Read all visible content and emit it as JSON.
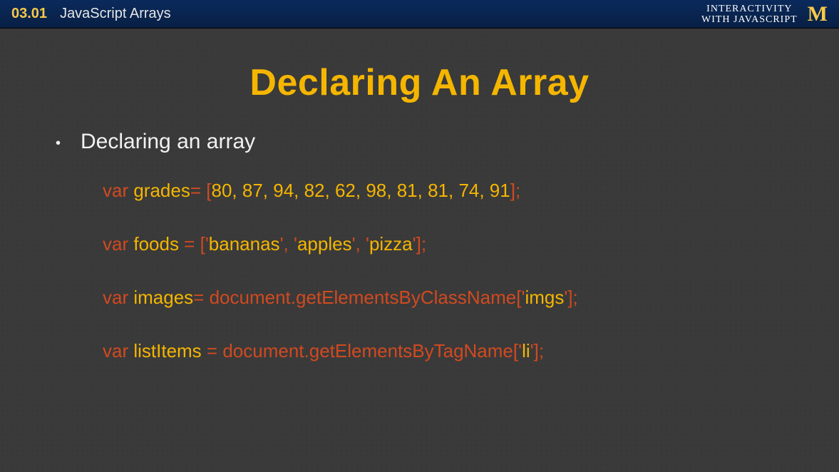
{
  "header": {
    "slide_number": "03.01",
    "topic": "JavaScript Arrays",
    "course_line1": "INTERACTIVITY",
    "course_line2": "WITH JAVASCRIPT",
    "logo_text": "M"
  },
  "slide": {
    "title": "Declaring An Array",
    "bullet": "Declaring an array",
    "code": {
      "line1": {
        "var": "var ",
        "name": "grades",
        "eq": "= ",
        "open": "[",
        "vals": "80, 87, 94, 82, 62, 98, 81, 81, 74, 91",
        "close": "];"
      },
      "line2": {
        "var": "var ",
        "name": "foods ",
        "eq": "= ",
        "open": "[",
        "v1q": "'",
        "v1": "bananas",
        "sep1": "', '",
        "v2": "apples",
        "sep2": "', '",
        "v3": "pizza",
        "endq": "'",
        "close": "];"
      },
      "line3": {
        "var": "var ",
        "name": "images",
        "eq": "= ",
        "call": "document.getElementsByClassName[",
        "q1": "'",
        "arg": "imgs",
        "q2": "'",
        "close": "];"
      },
      "line4": {
        "var": "var ",
        "name": "listItems ",
        "eq": "= ",
        "call": "document.getElementsByTagName[",
        "q1": "'",
        "arg": "li",
        "q2": "'",
        "close": "];"
      }
    }
  }
}
